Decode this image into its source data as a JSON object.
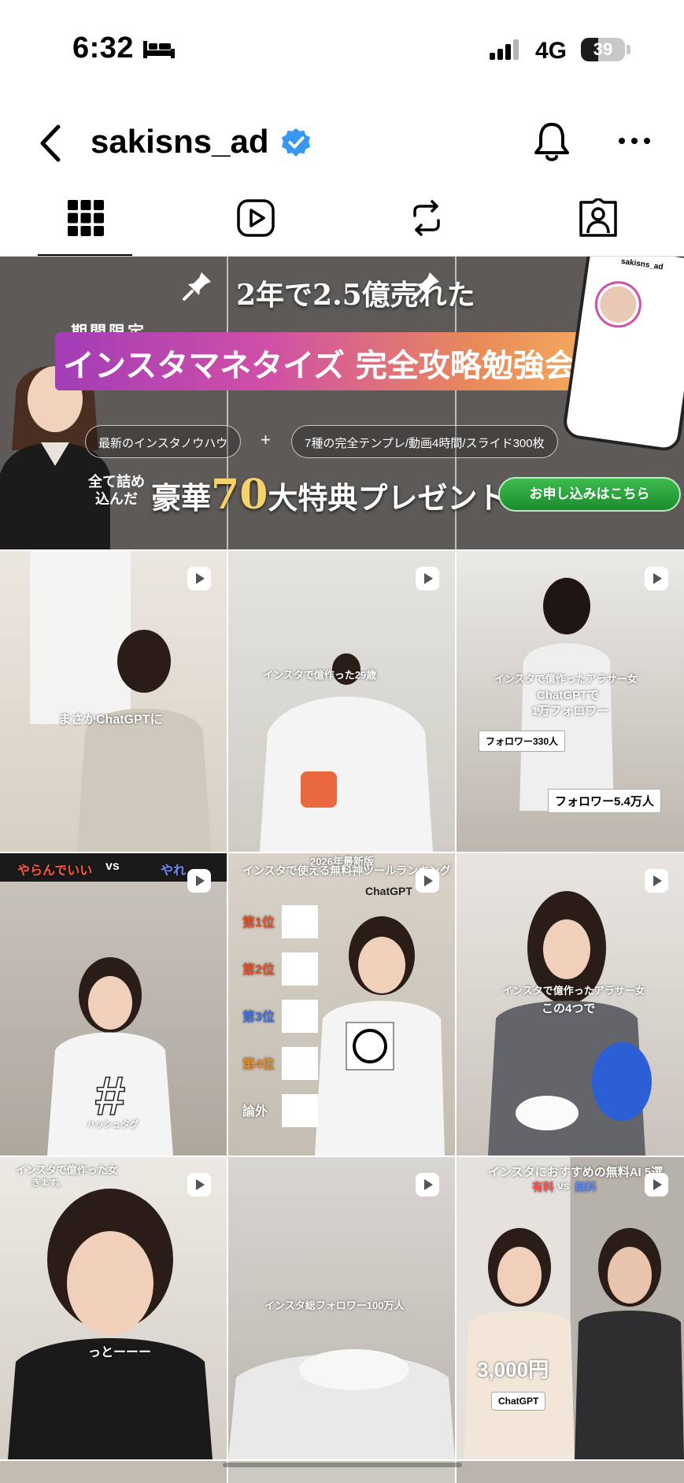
{
  "status_bar": {
    "time": "6:32",
    "network": "4G",
    "battery": "39",
    "battery_level_percent": 39,
    "icons": [
      "bed-icon",
      "signal-icon",
      "battery-icon"
    ]
  },
  "header": {
    "username": "sakisns_ad",
    "verified": true,
    "icons": [
      "back-chevron-icon",
      "verified-badge-icon",
      "bell-icon",
      "more-dots-icon"
    ],
    "accent_color": "#3897f0"
  },
  "tabs": [
    {
      "name": "grid",
      "icon": "grid-icon",
      "active": true
    },
    {
      "name": "reels",
      "icon": "reels-icon",
      "active": false
    },
    {
      "name": "reposts",
      "icon": "repost-icon",
      "active": false
    },
    {
      "name": "tagged",
      "icon": "tagged-person-icon",
      "active": false
    }
  ],
  "banner": {
    "headline": "2年で2.5億売れた",
    "limited": "期間限定",
    "title": "インスタマネタイズ 完全攻略勉強会",
    "chip_1": "最新のインスタノウハウ",
    "plus": "+",
    "chip_2": "7種の完全テンプレ/動画4時間/スライド300枚",
    "all_in": "全て詰め\n込んだ",
    "gift_pre": "豪華",
    "gift_num": "70",
    "gift_post": "大特典プレゼント!",
    "cta": "お申し込みはこちら",
    "phone_name": "sakisns_ad",
    "pinned_count": 3
  },
  "posts": [
    {
      "type": "reel",
      "caption": "まさかChatGPTに"
    },
    {
      "type": "reel",
      "caption": "インスタで億作った29歳"
    },
    {
      "type": "reel",
      "caption_1": "インスタで億作ったアラサー女",
      "caption_2": "ChatGPTで",
      "caption_3": "1万フォロワー",
      "label_1": "フォロワー330人",
      "label_2": "フォロワー5.4万人"
    },
    {
      "type": "reel",
      "caption_1": "やらんでいい",
      "caption_2": "vs",
      "caption_3": "やれ",
      "caption_4": "ハッシュタグ"
    },
    {
      "type": "reel",
      "caption_1": "2026年最新版",
      "caption_2": "インスタで使える無料神ツールランキング",
      "caption_3": "ChatGPT",
      "rank_1": "第1位",
      "rank_2": "第2位",
      "rank_3": "第3位",
      "rank_4": "第4位",
      "rank_5": "論外"
    },
    {
      "type": "reel",
      "caption_1": "インスタで億作ったアラサー女",
      "caption_2": "この4つで"
    },
    {
      "type": "reel",
      "caption_1": "インスタで億作った女",
      "caption_2": "きます。",
      "caption_3": "っとーーー"
    },
    {
      "type": "reel",
      "caption": "インスタ総フォロワー100万人"
    },
    {
      "type": "reel",
      "caption_1": "インスタにおすすめの無料AI 5選",
      "caption_2": "有料",
      "caption_3": "vs",
      "caption_4": "無料",
      "caption_5": "3,000円",
      "caption_6": "ChatGPT"
    }
  ]
}
